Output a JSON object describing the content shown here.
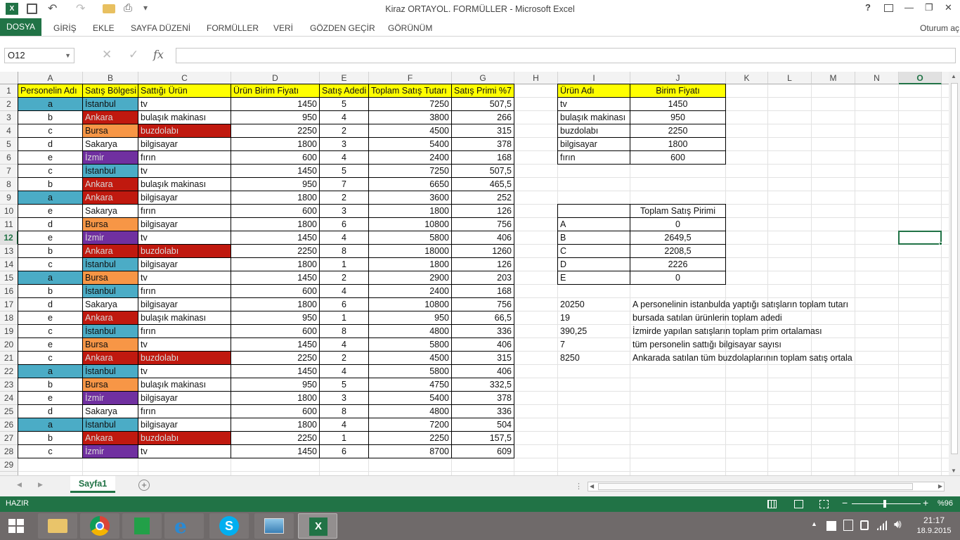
{
  "window": {
    "title": "Kiraz ORTAYOL. FORMÜLLER - Microsoft Excel",
    "help": "?",
    "minimize": "—",
    "restore": "❐",
    "close": "✕"
  },
  "ribbon": {
    "file_tab": "DOSYA",
    "tabs": [
      "GİRİŞ",
      "EKLE",
      "SAYFA DÜZENİ",
      "FORMÜLLER",
      "VERİ",
      "GÖZDEN GEÇİR",
      "GÖRÜNÜM"
    ],
    "account": "Oturum aç"
  },
  "formula_bar": {
    "name_box": "O12",
    "fx": "fx",
    "formula": ""
  },
  "columns": [
    "A",
    "B",
    "C",
    "D",
    "E",
    "F",
    "G",
    "H",
    "I",
    "J",
    "K",
    "L",
    "M",
    "N",
    "O",
    "P"
  ],
  "row_numbers": [
    "1",
    "2",
    "3",
    "4",
    "5",
    "6",
    "7",
    "8",
    "9",
    "10",
    "11",
    "12",
    "13",
    "14",
    "15",
    "16",
    "17",
    "18",
    "19",
    "20",
    "21",
    "22",
    "23",
    "24",
    "25",
    "26",
    "27",
    "28",
    "29"
  ],
  "main_table": {
    "headers": [
      "Personelin Adı",
      "Satış Bölgesi",
      "Sattığı Ürün",
      "Ürün Birim Fiyatı",
      "Satış Adedi",
      "Toplam Satış Tutarı",
      "Satış Primi %7"
    ],
    "rows": [
      [
        "a",
        "İstanbul",
        "tv",
        "1450",
        "5",
        "7250",
        "507,5"
      ],
      [
        "b",
        "Ankara",
        "bulaşık makinası",
        "950",
        "4",
        "3800",
        "266"
      ],
      [
        "c",
        "Bursa",
        "buzdolabı",
        "2250",
        "2",
        "4500",
        "315"
      ],
      [
        "d",
        "Sakarya",
        "bilgisayar",
        "1800",
        "3",
        "5400",
        "378"
      ],
      [
        "e",
        "İzmir",
        "fırın",
        "600",
        "4",
        "2400",
        "168"
      ],
      [
        "c",
        "İstanbul",
        "tv",
        "1450",
        "5",
        "7250",
        "507,5"
      ],
      [
        "b",
        "Ankara",
        "bulaşık makinası",
        "950",
        "7",
        "6650",
        "465,5"
      ],
      [
        "a",
        "Ankara",
        "bilgisayar",
        "1800",
        "2",
        "3600",
        "252"
      ],
      [
        "e",
        "Sakarya",
        "fırın",
        "600",
        "3",
        "1800",
        "126"
      ],
      [
        "d",
        "Bursa",
        "bilgisayar",
        "1800",
        "6",
        "10800",
        "756"
      ],
      [
        "e",
        "İzmir",
        "tv",
        "1450",
        "4",
        "5800",
        "406"
      ],
      [
        "b",
        "Ankara",
        "buzdolabı",
        "2250",
        "8",
        "18000",
        "1260"
      ],
      [
        "c",
        "İstanbul",
        "bilgisayar",
        "1800",
        "1",
        "1800",
        "126"
      ],
      [
        "a",
        "Bursa",
        "tv",
        "1450",
        "2",
        "2900",
        "203"
      ],
      [
        "b",
        "İstanbul",
        "fırın",
        "600",
        "4",
        "2400",
        "168"
      ],
      [
        "d",
        "Sakarya",
        "bilgisayar",
        "1800",
        "6",
        "10800",
        "756"
      ],
      [
        "e",
        "Ankara",
        "bulaşık makinası",
        "950",
        "1",
        "950",
        "66,5"
      ],
      [
        "c",
        "İstanbul",
        "fırın",
        "600",
        "8",
        "4800",
        "336"
      ],
      [
        "e",
        "Bursa",
        "tv",
        "1450",
        "4",
        "5800",
        "406"
      ],
      [
        "c",
        "Ankara",
        "buzdolabı",
        "2250",
        "2",
        "4500",
        "315"
      ],
      [
        "a",
        "İstanbul",
        "tv",
        "1450",
        "4",
        "5800",
        "406"
      ],
      [
        "b",
        "Bursa",
        "bulaşık makinası",
        "950",
        "5",
        "4750",
        "332,5"
      ],
      [
        "e",
        "İzmir",
        "bilgisayar",
        "1800",
        "3",
        "5400",
        "378"
      ],
      [
        "d",
        "Sakarya",
        "fırın",
        "600",
        "8",
        "4800",
        "336"
      ],
      [
        "a",
        "İstanbul",
        "bilgisayar",
        "1800",
        "4",
        "7200",
        "504"
      ],
      [
        "b",
        "Ankara",
        "buzdolabı",
        "2250",
        "1",
        "2250",
        "157,5"
      ],
      [
        "c",
        "İzmir",
        "tv",
        "1450",
        "6",
        "8700",
        "609"
      ]
    ]
  },
  "price_table": {
    "headers": [
      "Ürün Adı",
      "Birim Fiyatı"
    ],
    "rows": [
      [
        "tv",
        "1450"
      ],
      [
        "bulaşık makinası",
        "950"
      ],
      [
        "buzdolabı",
        "2250"
      ],
      [
        "bilgisayar",
        "1800"
      ],
      [
        "fırın",
        "600"
      ]
    ]
  },
  "prim_table": {
    "header": "Toplam Satış Pirimi",
    "rows": [
      [
        "A",
        "0"
      ],
      [
        "B",
        "2649,5"
      ],
      [
        "C",
        "2208,5"
      ],
      [
        "D",
        "2226"
      ],
      [
        "E",
        "0"
      ]
    ]
  },
  "summary": [
    [
      "20250",
      "A personelinin istanbulda yaptığı satışların toplam tutarı"
    ],
    [
      "19",
      "bursada satılan ürünlerin toplam adedi"
    ],
    [
      "390,25",
      "İzmirde yapılan satışların toplam prim ortalaması"
    ],
    [
      "7",
      "tüm personelin sattığı bilgisayar sayısı"
    ],
    [
      "8250",
      "Ankarada satılan tüm buzdolaplarının toplam satış ortala"
    ]
  ],
  "colors": {
    "person_a": "#4bacc6",
    "istanbul": "#4bacc6",
    "ankara": "#c0190f",
    "bursa": "#f79646",
    "izmir": "#7030a0",
    "buzdolabi": "#c0190f",
    "header_yellow": "#ffff00",
    "excel_green": "#217346"
  },
  "sheet_tab": {
    "name": "Sayfa1",
    "add": "+"
  },
  "status": {
    "ready": "HAZIR",
    "zoom": "%96"
  },
  "taskbar": {
    "time": "21:17",
    "date": "18.9.2015"
  }
}
